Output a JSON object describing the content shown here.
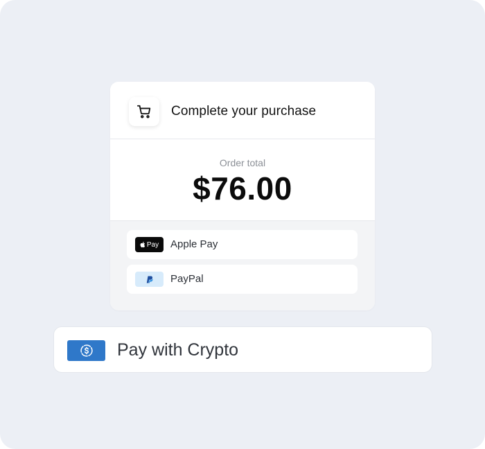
{
  "header": {
    "title": "Complete your purchase",
    "icon": "cart-icon"
  },
  "order": {
    "label": "Order total",
    "amount": "$76.00"
  },
  "payment_methods": [
    {
      "label": "Apple Pay",
      "badge_text": "Pay",
      "icon": "apple-pay-icon"
    },
    {
      "label": "PayPal",
      "icon": "paypal-icon"
    }
  ],
  "crypto": {
    "label": "Pay with Crypto",
    "icon": "dollar-coin-icon"
  },
  "colors": {
    "background": "#eceff5",
    "crypto_badge": "#2f78c9",
    "paypal_badge": "#d7ebfb",
    "paypal_blue": "#1f4fa0"
  }
}
